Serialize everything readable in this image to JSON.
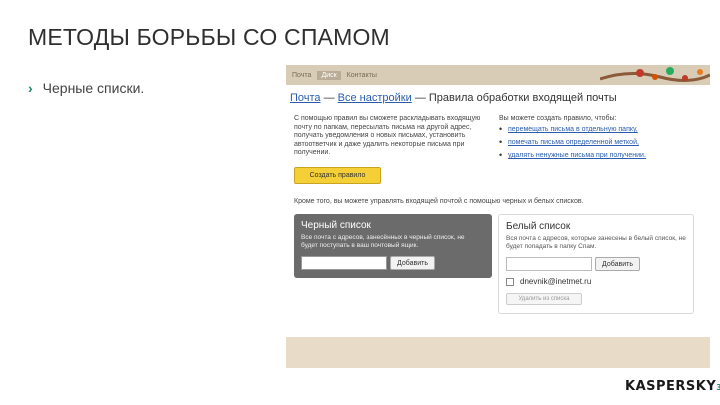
{
  "slide": {
    "title": "МЕТОДЫ БОРЬБЫ СО СПАМОМ",
    "bullet": "Черные списки.",
    "logo": "KASPERSKY",
    "logo_mark": "3"
  },
  "mail": {
    "tabs": [
      "Почта",
      "Диск",
      "Контакты"
    ],
    "crumbs": {
      "part1": "Почта",
      "sep": "—",
      "part2": "Все настройки",
      "part3": "Правила обработки входящей почты"
    },
    "intro": "С помощью правил вы сможете раскладывать входящую почту по папкам, пересылать письма на другой адрес, получать уведомления о новых письмах, установить автоответчик и даже удалить некоторые письма при получении.",
    "create_button": "Создать правило",
    "right_title": "Вы можете создать правило, чтобы:",
    "right_items": [
      "перемещать письма в отдельную папку,",
      "помечать письма определенной меткой,",
      "удалять ненужные письма при получении."
    ],
    "also_text": "Кроме того, вы можете управлять входящей почтой с помощью черных и белых списков.",
    "blacklist": {
      "title": "Черный список",
      "desc": "Все почта с адресов, занесённых в черный список, не будет поступать в ваш почтовый ящик.",
      "input_placeholder": "",
      "add_button": "Добавить"
    },
    "whitelist": {
      "title": "Белый список",
      "desc": "Вся почта с адресов, которые занесены в белый список, не будет попадать в папку Спам.",
      "input_placeholder": "",
      "add_button": "Добавить",
      "entry": "dnevnik@inetmet.ru",
      "remove_button": "Удалить из списка"
    }
  },
  "colors": {
    "accent": "#1a8a6e",
    "link": "#2a5db0",
    "yellow_button": "#f4cf37",
    "dark_panel": "#6b6b6b"
  }
}
